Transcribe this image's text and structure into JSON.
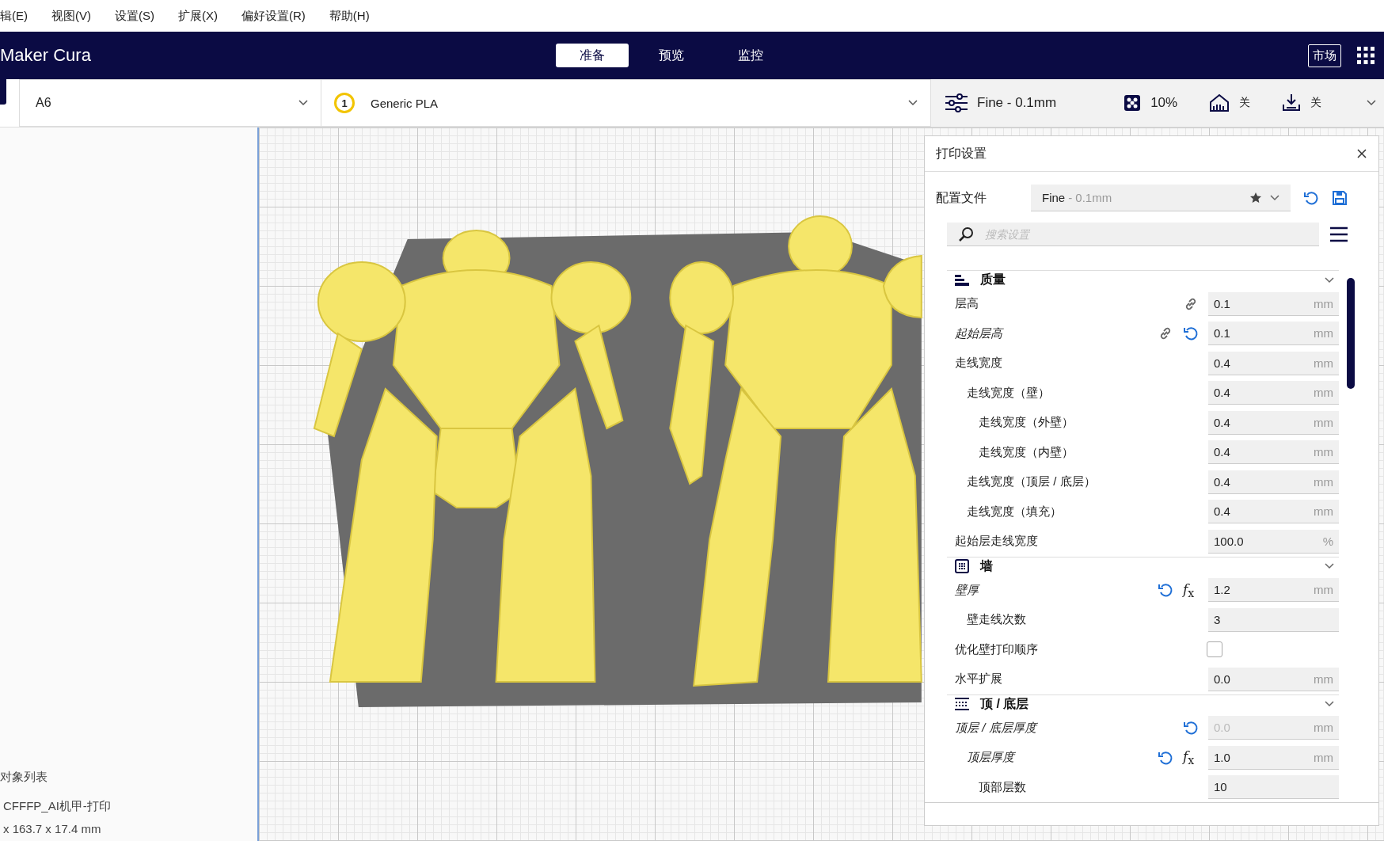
{
  "menu": [
    "辑(E)",
    "视图(V)",
    "设置(S)",
    "扩展(X)",
    "偏好设置(R)",
    "帮助(H)"
  ],
  "header": {
    "app_name": "Maker Cura",
    "marketplace": "市场",
    "stages": [
      {
        "label": "准备",
        "selected": true
      },
      {
        "label": "预览",
        "selected": false
      },
      {
        "label": "监控",
        "selected": false
      }
    ]
  },
  "toolbar": {
    "printer": "A6",
    "extruder_number": "1",
    "material": "Generic PLA",
    "profile": "Fine - 0.1mm",
    "infill": "10%",
    "support": "关",
    "adhesion": "关"
  },
  "object_list": {
    "title": "对象列表",
    "object_name": "CFFFP_AI机甲-打印",
    "dimensions": "x 163.7 x 17.4 mm"
  },
  "print_settings": {
    "title": "打印设置",
    "profile_label": "配置文件",
    "profile_name": "Fine",
    "profile_detail": "- 0.1mm",
    "search_placeholder": "搜索设置",
    "sections": [
      {
        "title": "质量",
        "expanded": true,
        "settings": [
          {
            "kind": "field",
            "label": "层高",
            "italic": false,
            "linked": true,
            "resettable": false,
            "value": "0.1",
            "unit": "mm",
            "disabled": false
          },
          {
            "kind": "field",
            "label": "起始层高",
            "italic": true,
            "linked": true,
            "resettable": true,
            "value": "0.1",
            "unit": "mm",
            "disabled": false
          },
          {
            "kind": "field",
            "label": "走线宽度",
            "italic": false,
            "linked": false,
            "resettable": false,
            "value": "0.4",
            "unit": "mm",
            "disabled": false,
            "children": [
              {
                "kind": "field",
                "label": "走线宽度（壁）",
                "italic": false,
                "linked": false,
                "resettable": false,
                "value": "0.4",
                "unit": "mm",
                "disabled": false,
                "children": [
                  {
                    "kind": "field",
                    "label": "走线宽度（外壁）",
                    "italic": false,
                    "linked": false,
                    "resettable": false,
                    "value": "0.4",
                    "unit": "mm",
                    "disabled": false
                  },
                  {
                    "kind": "field",
                    "label": "走线宽度（内壁）",
                    "italic": false,
                    "linked": false,
                    "resettable": false,
                    "value": "0.4",
                    "unit": "mm",
                    "disabled": false
                  }
                ]
              },
              {
                "kind": "field",
                "label": "走线宽度（顶层 / 底层）",
                "italic": false,
                "linked": false,
                "resettable": false,
                "value": "0.4",
                "unit": "mm",
                "disabled": false
              },
              {
                "kind": "field",
                "label": "走线宽度（填充）",
                "italic": false,
                "linked": false,
                "resettable": false,
                "value": "0.4",
                "unit": "mm",
                "disabled": false
              }
            ]
          },
          {
            "kind": "field",
            "label": "起始层走线宽度",
            "italic": false,
            "linked": false,
            "resettable": false,
            "value": "100.0",
            "unit": "%",
            "disabled": false
          }
        ]
      },
      {
        "title": "墙",
        "expanded": true,
        "settings": [
          {
            "kind": "field",
            "label": "壁厚",
            "italic": true,
            "linked": false,
            "resettable": true,
            "formula_button": "*f*$_{x}$",
            "value": "1.2",
            "unit": "mm",
            "disabled": false,
            "children": [
              {
                "kind": "field",
                "label": "壁走线次数",
                "italic": false,
                "linked": false,
                "resettable": false,
                "value": "3",
                "disabled": false
              }
            ]
          },
          {
            "kind": "checkbox",
            "label": "优化壁打印顺序",
            "italic": false,
            "linked": false,
            "resettable": false,
            "checked": false
          },
          {
            "kind": "field",
            "label": "水平扩展",
            "italic": false,
            "linked": false,
            "resettable": false,
            "value": "0.0",
            "unit": "mm",
            "disabled": false
          }
        ]
      },
      {
        "title": "顶 / 底层",
        "expanded": true,
        "settings": [
          {
            "kind": "field",
            "label": "顶层 / 底层厚度",
            "italic": true,
            "linked": false,
            "resettable": true,
            "value": "0.0",
            "unit": "mm",
            "disabled": true,
            "children": [
              {
                "kind": "field",
                "label": "顶层厚度",
                "italic": true,
                "linked": false,
                "resettable": true,
                "formula_button": "*f*$_{x}$",
                "value": "1.0",
                "unit": "mm",
                "disabled": false,
                "children": [
                  {
                    "kind": "field",
                    "label": "顶部层数",
                    "italic": false,
                    "linked": false,
                    "resettable": false,
                    "value": "10",
                    "disabled": false
                  }
                ]
              }
            ]
          }
        ]
      }
    ]
  }
}
